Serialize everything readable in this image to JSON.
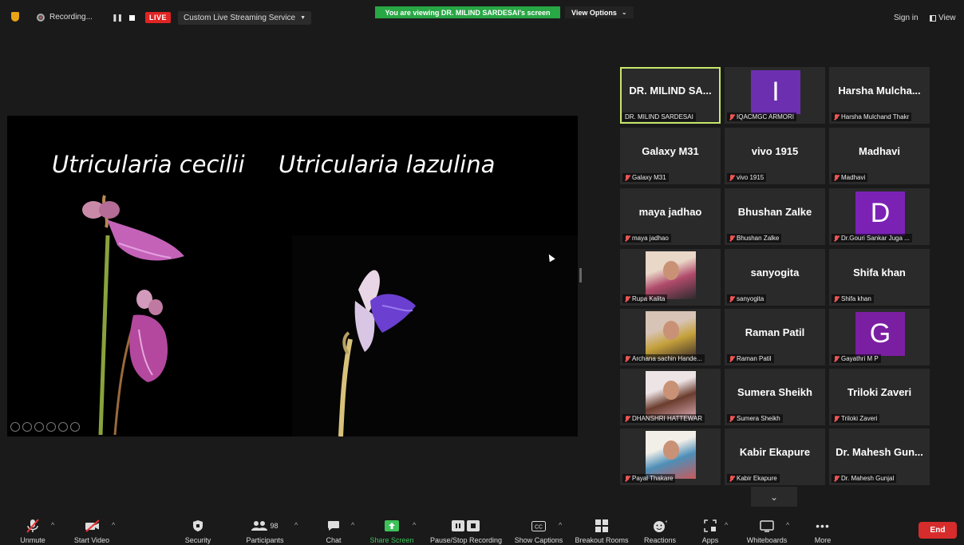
{
  "topbar": {
    "recording_label": "Recording...",
    "live_label": "LIVE",
    "stream_label": "Custom Live Streaming Service",
    "banner": "You are viewing DR. MILIND SARDESAI's screen",
    "view_options": "View Options",
    "sign_in": "Sign in",
    "view": "View"
  },
  "slide": {
    "title_left": "Utricularia cecilii",
    "title_right": "Utricularia lazulina"
  },
  "participants": [
    {
      "tile_name": "DR. MILIND SA...",
      "caption": "DR. MILIND SARDESAI",
      "muted": false,
      "active": true
    },
    {
      "tile_name": "",
      "caption": "IQACMGC ARMORI",
      "muted": true,
      "avatar_letter": "I",
      "avatar_color": "#6c2fb0"
    },
    {
      "tile_name": "Harsha  Mulcha...",
      "caption": "Harsha Mulchand Thakr",
      "muted": true
    },
    {
      "tile_name": "Galaxy M31",
      "caption": "Galaxy M31",
      "muted": true
    },
    {
      "tile_name": "vivo 1915",
      "caption": "vivo 1915",
      "muted": true
    },
    {
      "tile_name": "Madhavi",
      "caption": "Madhavi",
      "muted": true
    },
    {
      "tile_name": "maya jadhao",
      "caption": "maya jadhao",
      "muted": true
    },
    {
      "tile_name": "Bhushan Zalke",
      "caption": "Bhushan Zalke",
      "muted": true
    },
    {
      "tile_name": "",
      "caption": "Dr.Gouri Sankar Juga ...",
      "muted": true,
      "avatar_letter": "D",
      "avatar_color": "#7b22b5"
    },
    {
      "tile_name": "",
      "caption": "Rupa Kalita",
      "muted": true,
      "photo": true
    },
    {
      "tile_name": "sanyogita",
      "caption": "sanyogita",
      "muted": true
    },
    {
      "tile_name": "Shifa khan",
      "caption": "Shifa khan",
      "muted": true
    },
    {
      "tile_name": "",
      "caption": "Archana sachin Hande...",
      "muted": true,
      "photo": true
    },
    {
      "tile_name": "Raman Patil",
      "caption": "Raman Patil",
      "muted": true
    },
    {
      "tile_name": "",
      "caption": "Gayathri M P",
      "muted": true,
      "avatar_letter": "G",
      "avatar_color": "#7b1fa2"
    },
    {
      "tile_name": "",
      "caption": "DHANSHRI HATTEWAR",
      "muted": true,
      "photo": true
    },
    {
      "tile_name": "Sumera Sheikh",
      "caption": "Sumera Sheikh",
      "muted": true
    },
    {
      "tile_name": "Triloki Zaveri",
      "caption": "Triloki Zaveri",
      "muted": true
    },
    {
      "tile_name": "",
      "caption": "Payal Thakare",
      "muted": true,
      "photo": true
    },
    {
      "tile_name": "Kabir Ekapure",
      "caption": "Kabir Ekapure",
      "muted": true
    },
    {
      "tile_name": "Dr. Mahesh Gun...",
      "caption": "Dr. Mahesh Gunjal",
      "muted": true
    }
  ],
  "toolbar": {
    "unmute": "Unmute",
    "start_video": "Start Video",
    "security": "Security",
    "participants": "Participants",
    "participant_count": "98",
    "chat": "Chat",
    "share_screen": "Share Screen",
    "pause_recording": "Pause/Stop Recording",
    "show_captions": "Show Captions",
    "breakout_rooms": "Breakout Rooms",
    "reactions": "Reactions",
    "apps": "Apps",
    "whiteboards": "Whiteboards",
    "more": "More",
    "end": "End"
  },
  "colors": {
    "banner_green": "#28a745",
    "live_red": "#e02424",
    "end_red": "#d72c2c",
    "active_speaker_border": "#c8e66b"
  }
}
